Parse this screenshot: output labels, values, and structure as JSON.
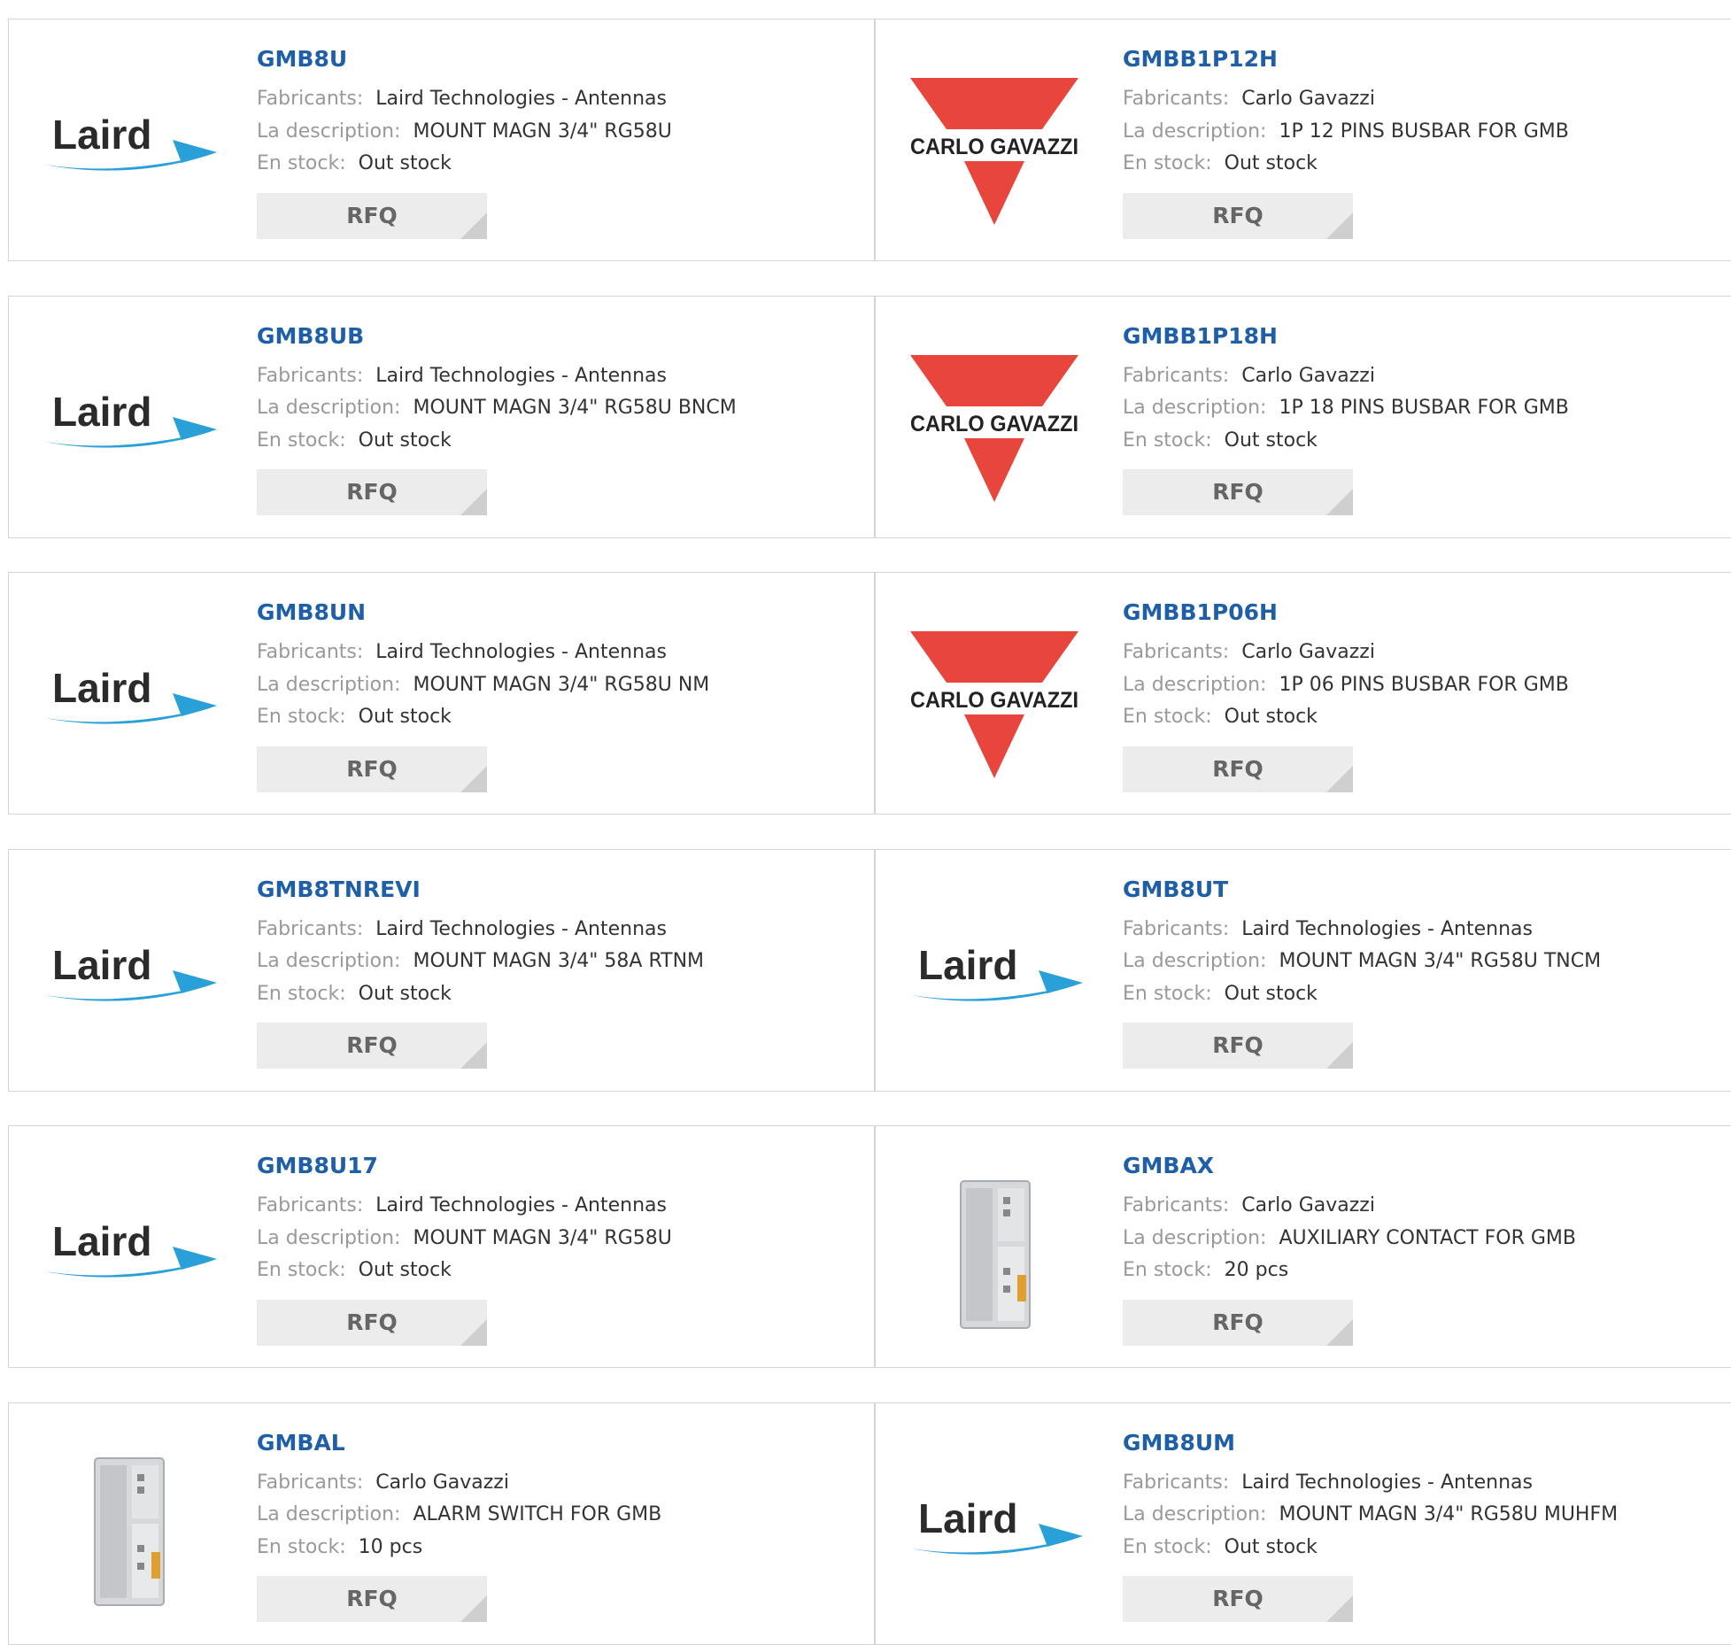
{
  "labels": {
    "manufacturer": "Fabricants:",
    "description": "La description:",
    "stock": "En stock:",
    "rfq": "RFQ"
  },
  "brands": {
    "laird": {
      "name": "Laird",
      "color": "#2b2b2b",
      "swoosh_color": "#2aa0d8",
      "icon": "laird-logo"
    },
    "carlo": {
      "name": "CARLO GAVAZZI",
      "color": "#e8453c",
      "icon": "carlo-gavazzi-logo"
    }
  },
  "products": [
    {
      "part": "GMB8U",
      "manufacturer": "Laird Technologies - Antennas",
      "description": "MOUNT MAGN 3/4\" RG58U",
      "stock": "Out stock",
      "logo": "laird"
    },
    {
      "part": "GMBB1P12H",
      "manufacturer": "Carlo Gavazzi",
      "description": "1P 12 PINS BUSBAR FOR GMB",
      "stock": "Out stock",
      "logo": "carlo"
    },
    {
      "part": "GMB8UB",
      "manufacturer": "Laird Technologies - Antennas",
      "description": "MOUNT MAGN 3/4\" RG58U BNCM",
      "stock": "Out stock",
      "logo": "laird"
    },
    {
      "part": "GMBB1P18H",
      "manufacturer": "Carlo Gavazzi",
      "description": "1P 18 PINS BUSBAR FOR GMB",
      "stock": "Out stock",
      "logo": "carlo"
    },
    {
      "part": "GMB8UN",
      "manufacturer": "Laird Technologies - Antennas",
      "description": "MOUNT MAGN 3/4\" RG58U NM",
      "stock": "Out stock",
      "logo": "laird"
    },
    {
      "part": "GMBB1P06H",
      "manufacturer": "Carlo Gavazzi",
      "description": "1P 06 PINS BUSBAR FOR GMB",
      "stock": "Out stock",
      "logo": "carlo"
    },
    {
      "part": "GMB8TNREVI",
      "manufacturer": "Laird Technologies - Antennas",
      "description": "MOUNT MAGN 3/4\" 58A RTNM",
      "stock": "Out stock",
      "logo": "laird"
    },
    {
      "part": "GMB8UT",
      "manufacturer": "Laird Technologies - Antennas",
      "description": "MOUNT MAGN 3/4\" RG58U TNCM",
      "stock": "Out stock",
      "logo": "laird"
    },
    {
      "part": "GMB8U17",
      "manufacturer": "Laird Technologies - Antennas",
      "description": "MOUNT MAGN 3/4\" RG58U",
      "stock": "Out stock",
      "logo": "laird"
    },
    {
      "part": "GMBAX",
      "manufacturer": "Carlo Gavazzi",
      "description": "AUXILIARY CONTACT FOR GMB",
      "stock": "20 pcs",
      "logo": "device"
    },
    {
      "part": "GMBAL",
      "manufacturer": "Carlo Gavazzi",
      "description": "ALARM SWITCH FOR GMB",
      "stock": "10 pcs",
      "logo": "device"
    },
    {
      "part": "GMB8UM",
      "manufacturer": "Laird Technologies - Antennas",
      "description": "MOUNT MAGN 3/4\" RG58U MUHFM",
      "stock": "Out stock",
      "logo": "laird"
    }
  ]
}
